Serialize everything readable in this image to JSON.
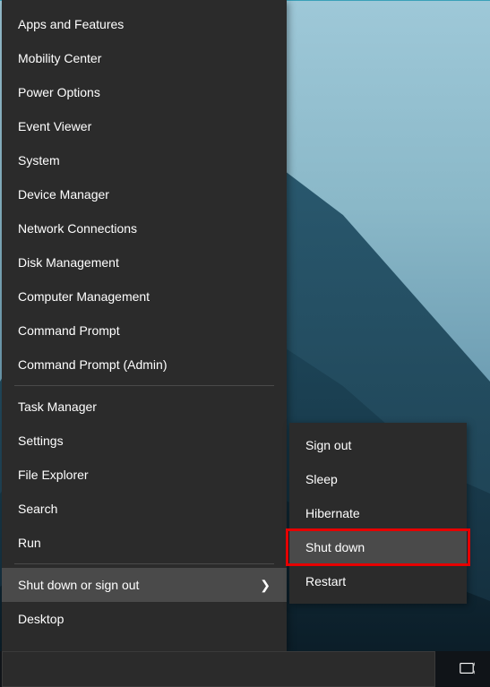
{
  "menu": {
    "items": [
      {
        "label": "Apps and Features",
        "name": "apps-and-features"
      },
      {
        "label": "Mobility Center",
        "name": "mobility-center"
      },
      {
        "label": "Power Options",
        "name": "power-options"
      },
      {
        "label": "Event Viewer",
        "name": "event-viewer"
      },
      {
        "label": "System",
        "name": "system"
      },
      {
        "label": "Device Manager",
        "name": "device-manager"
      },
      {
        "label": "Network Connections",
        "name": "network-connections"
      },
      {
        "label": "Disk Management",
        "name": "disk-management"
      },
      {
        "label": "Computer Management",
        "name": "computer-management"
      },
      {
        "label": "Command Prompt",
        "name": "command-prompt"
      },
      {
        "label": "Command Prompt (Admin)",
        "name": "command-prompt-admin"
      }
    ],
    "items2": [
      {
        "label": "Task Manager",
        "name": "task-manager"
      },
      {
        "label": "Settings",
        "name": "settings"
      },
      {
        "label": "File Explorer",
        "name": "file-explorer"
      },
      {
        "label": "Search",
        "name": "search"
      },
      {
        "label": "Run",
        "name": "run"
      }
    ],
    "shutdown_label": "Shut down or sign out",
    "desktop_label": "Desktop"
  },
  "submenu": {
    "items": [
      {
        "label": "Sign out",
        "name": "sign-out"
      },
      {
        "label": "Sleep",
        "name": "sleep"
      },
      {
        "label": "Hibernate",
        "name": "hibernate"
      },
      {
        "label": "Shut down",
        "name": "shut-down",
        "highlighted": true
      },
      {
        "label": "Restart",
        "name": "restart"
      }
    ]
  }
}
